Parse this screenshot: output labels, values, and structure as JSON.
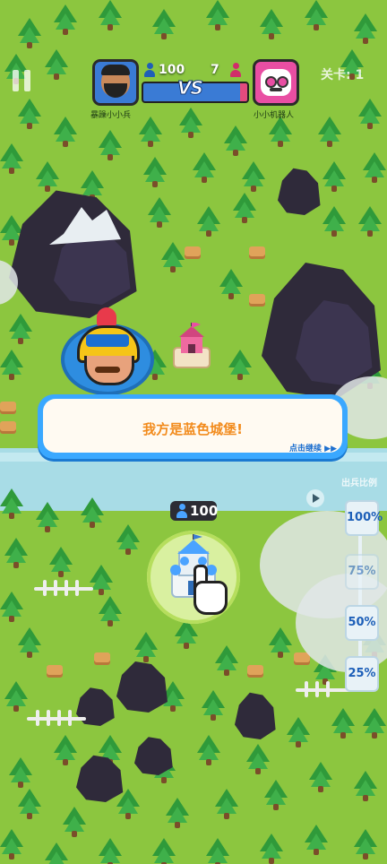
{
  "hud": {
    "pause_icon": "pause-icon",
    "player1": {
      "name": "暴躁小小兵",
      "troops": "100",
      "color": "#3a7bd5"
    },
    "player2": {
      "name": "小小机器人",
      "troops": "7",
      "color": "#e94ea3"
    },
    "vs_label": "VS",
    "level_label": "关卡: 1",
    "blue_share": 0.93
  },
  "popup": {
    "message": "我方是蓝色城堡!",
    "continue_hint": "点击继续 ▶▶"
  },
  "castle": {
    "blue_troops": "100"
  },
  "ratio_panel": {
    "title": "出兵比例",
    "options": [
      "100%",
      "75%",
      "50%",
      "25%"
    ],
    "selected": "100%"
  }
}
